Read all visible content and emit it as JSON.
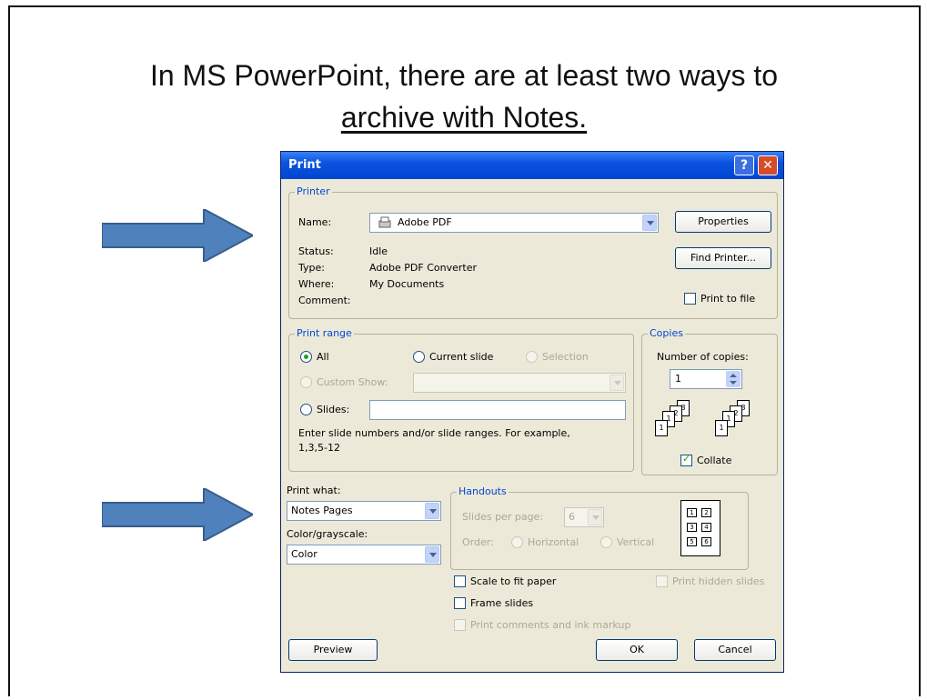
{
  "slide": {
    "title_line1": "In MS PowerPoint, there are at least two ways to",
    "title_line2": "archive with Notes."
  },
  "dialog": {
    "title": "Print",
    "help_icon_glyph": "?",
    "close_icon_glyph": "✕",
    "printer": {
      "group_label": "Printer",
      "name_label": "Name:",
      "name_value": "Adobe PDF",
      "properties_button": "Properties",
      "find_printer_button": "Find Printer...",
      "status_label": "Status:",
      "status_value": "Idle",
      "type_label": "Type:",
      "type_value": "Adobe PDF Converter",
      "where_label": "Where:",
      "where_value": "My Documents",
      "comment_label": "Comment:",
      "print_to_file_label": "Print to file"
    },
    "print_range": {
      "group_label": "Print range",
      "all_label": "All",
      "current_slide_label": "Current slide",
      "selection_label": "Selection",
      "custom_show_label": "Custom Show:",
      "slides_label": "Slides:",
      "hint": "Enter slide numbers and/or slide ranges. For example,",
      "hint_example": "1,3,5-12"
    },
    "copies": {
      "group_label": "Copies",
      "number_label": "Number of copies:",
      "number_value": "1",
      "collate_label": "Collate"
    },
    "print_what": {
      "label": "Print what:",
      "value": "Notes Pages",
      "color_label": "Color/grayscale:",
      "color_value": "Color"
    },
    "handouts": {
      "group_label": "Handouts",
      "slides_per_page_label": "Slides per page:",
      "slides_per_page_value": "6",
      "order_label": "Order:",
      "horizontal_label": "Horizontal",
      "vertical_label": "Vertical",
      "preview_numbers": [
        "1",
        "2",
        "3",
        "4",
        "5",
        "6"
      ]
    },
    "options": {
      "scale_to_fit": "Scale to fit paper",
      "frame_slides": "Frame slides",
      "print_comments": "Print comments and ink markup",
      "print_hidden": "Print hidden slides"
    },
    "buttons": {
      "preview": "Preview",
      "ok": "OK",
      "cancel": "Cancel"
    }
  },
  "colors": {
    "arrow": "#4F81BD",
    "titlebar": "#0A53E0",
    "group_label": "#0046D5",
    "dialog_bg": "#ECE9D8"
  },
  "icons": {
    "arrows": "right-arrow-icon",
    "printer": "printer-icon"
  }
}
